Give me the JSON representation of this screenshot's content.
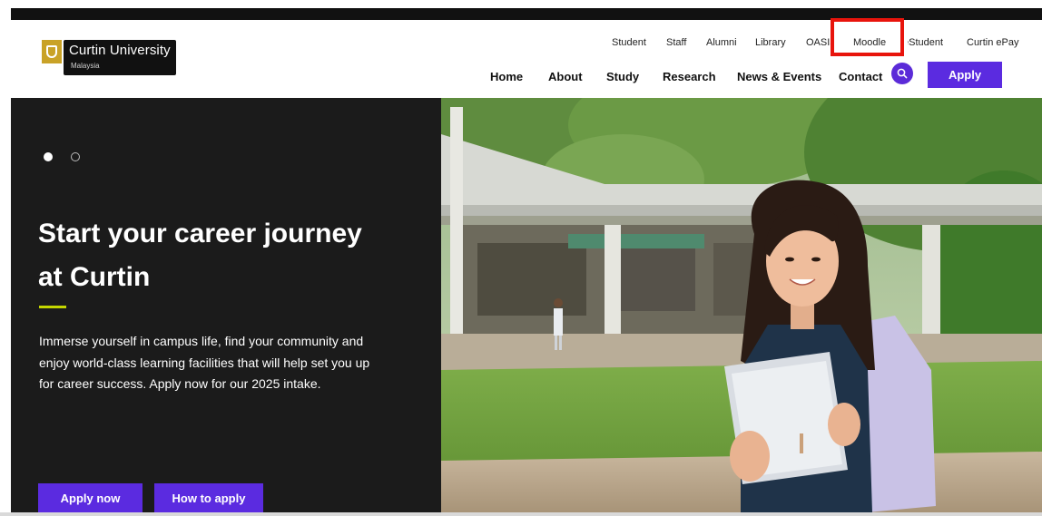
{
  "header": {
    "logo": {
      "name": "Curtin University",
      "sub": "Malaysia"
    },
    "utility_links": [
      "Student",
      "Staff",
      "Alumni",
      "Library",
      "OASIS",
      "Moodle",
      "eStudent",
      "Curtin ePay"
    ],
    "main_nav": [
      "Home",
      "About",
      "Study",
      "Research",
      "News & Events",
      "Contact"
    ],
    "apply_label": "Apply",
    "search_icon": "search-icon"
  },
  "hero": {
    "carousel_dots": 2,
    "active_dot": 1,
    "headline_line1": "Start your career journey",
    "headline_line2": "at Curtin",
    "intro": "Immerse yourself in campus life, find your community and enjoy world-class learning facilities that will help set you up for career success. Apply now for our 2025 intake.",
    "apply_now_label": "Apply now",
    "how_to_apply_label": "How to apply"
  },
  "colors": {
    "brand_purple": "#5b2be0",
    "accent_lime": "#c4d600",
    "highlight_red": "#e8140c",
    "hero_dark": "#1b1b1b"
  }
}
